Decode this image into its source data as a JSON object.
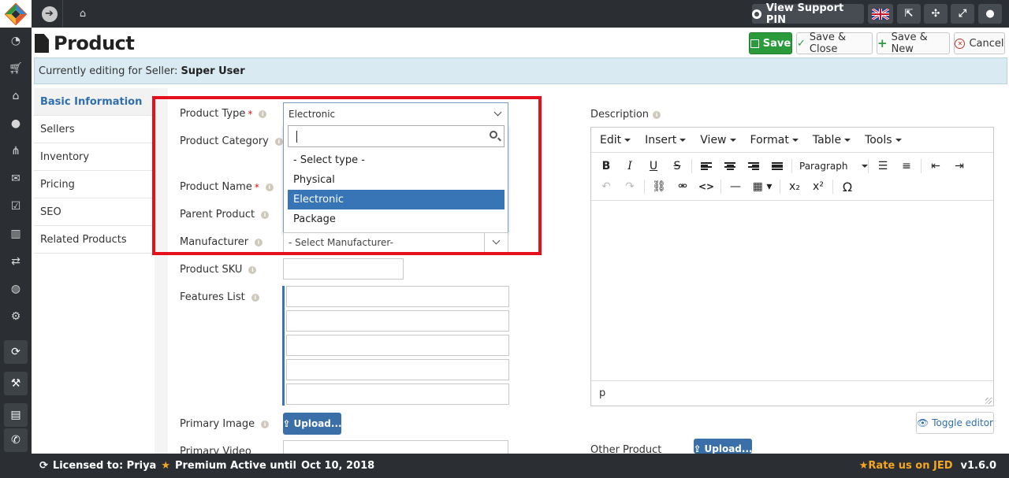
{
  "topbar": {
    "support_pin_label": "View Support PIN",
    "icons": [
      "app-logo",
      "toggle-sidebar-icon",
      "home-icon",
      "lifebuoy-icon",
      "uk-flag-icon",
      "external-link-icon",
      "joomla-icon",
      "fullscreen-icon",
      "user-icon"
    ]
  },
  "sidebar": {
    "icons": [
      "dashboard-icon",
      "cart-icon",
      "bank-icon",
      "user-icon",
      "sitemap-icon",
      "envelope-icon",
      "checkbox-icon",
      "bar-chart-icon",
      "exchange-icon",
      "globe-icon",
      "gear-icon",
      "refresh-icon",
      "wrench-icon",
      "book-icon",
      "phone-icon"
    ]
  },
  "header": {
    "title": "Product",
    "buttons": {
      "save": "Save",
      "save_close": "Save & Close",
      "save_new": "Save & New",
      "cancel": "Cancel"
    }
  },
  "banner": {
    "prefix": "Currently editing for Seller:",
    "seller": "Super User"
  },
  "subnav": {
    "items": [
      "Basic Information",
      "Sellers",
      "Inventory",
      "Pricing",
      "SEO",
      "Related Products"
    ],
    "active": "Basic Information"
  },
  "form": {
    "labels": {
      "product_type": "Product Type",
      "product_category": "Product Category",
      "product_name": "Product Name",
      "parent_product": "Parent Product",
      "manufacturer": "Manufacturer",
      "product_sku": "Product SKU",
      "features_list": "Features List",
      "primary_image": "Primary Image",
      "primary_video": "Primary Video",
      "other_product": "Other Product",
      "description": "Description"
    },
    "required_mark": "*",
    "product_type_value": "Electronic",
    "dropdown_options": [
      "- Select type -",
      "Physical",
      "Electronic",
      "Package"
    ],
    "dropdown_selected": "Electronic",
    "search_value": "",
    "manufacturer_value": "- Select Manufacturer-",
    "sku_value": "",
    "upload_label": "Upload..."
  },
  "editor": {
    "menus": [
      "Edit",
      "Insert",
      "View",
      "Format",
      "Table",
      "Tools"
    ],
    "block_format": "Paragraph",
    "status_path": "p",
    "toggle_label": "Toggle editor"
  },
  "footer": {
    "licensed": "Licensed to: Priya",
    "premium": "Premium Active until",
    "premium_date": "Oct 10, 2018",
    "rate": "Rate us on JED",
    "version": "v1.6.0"
  },
  "colors": {
    "dark_bar": "#2b2f33",
    "save_green": "#2a9a3a",
    "selection_blue": "#3875b6",
    "highlight_red": "#e4101b",
    "banner_blue": "#d9eaf3"
  }
}
